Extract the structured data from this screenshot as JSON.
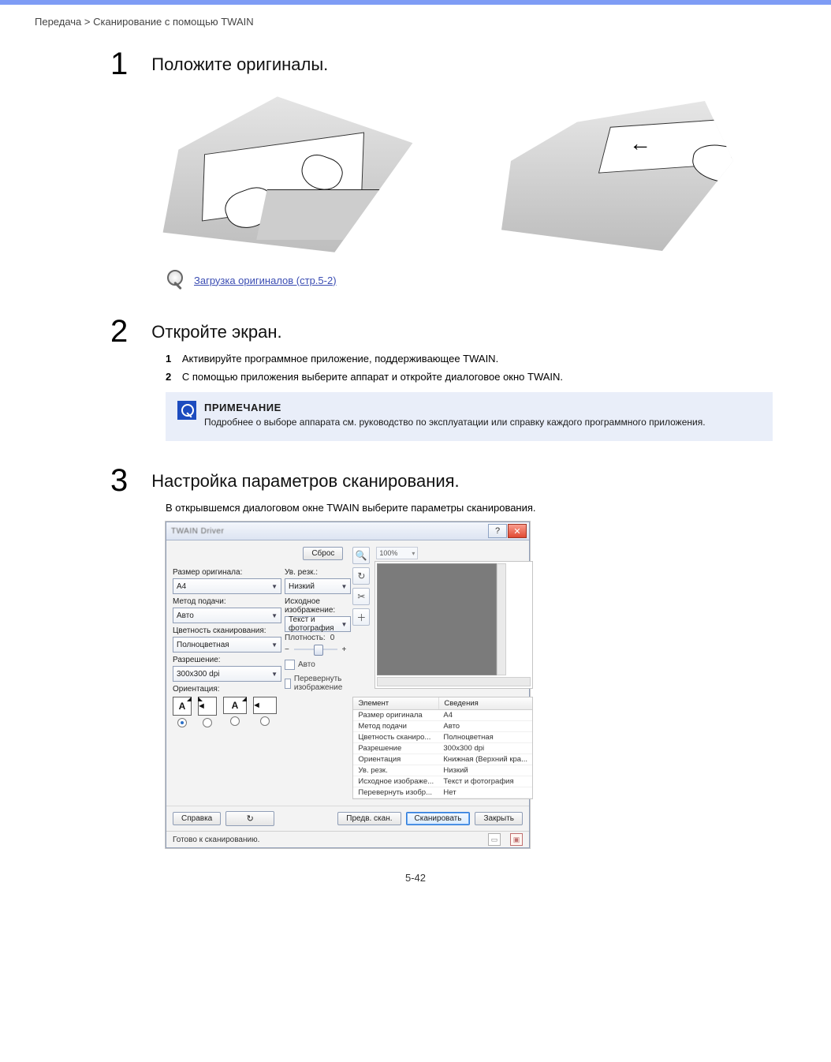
{
  "header": {
    "left": "Передача > Сканирование с помощью TWAIN",
    "page": "5-42"
  },
  "step1": {
    "num": "1",
    "title": "Положите оригиналы.",
    "ref_link": "Загрузка оригиналов (стр.5-2)"
  },
  "step2": {
    "num": "2",
    "title": "Откройте экран.",
    "lines": [
      {
        "label": "1",
        "text": "Активируйте программное приложение, поддерживающее TWAIN."
      },
      {
        "label": "2",
        "text": "С помощью приложения выберите аппарат и откройте диалоговое окно TWAIN."
      }
    ]
  },
  "note": {
    "title": "ПРИМЕЧАНИЕ",
    "body": "Подробнее о выборе аппарата см. руководство по эксплуатации или справку каждого программного приложения."
  },
  "step3": {
    "num": "3",
    "title": "Настройка параметров сканирования.",
    "sub": "В открывшемся диалоговом окне TWAIN выберите параметры сканирования."
  },
  "dialog": {
    "title_blur": "TWAIN Driver",
    "reset_btn": "Сброс",
    "left": {
      "orig_size_label": "Размер оригинала:",
      "orig_size_value": "A4",
      "feed_label": "Метод подачи:",
      "feed_value": "Авто",
      "color_label": "Цветность сканирования:",
      "color_value": "Полноцветная",
      "res_label": "Разрешение:",
      "res_value": "300x300 dpi",
      "orient_label": "Ориентация:"
    },
    "right_col": {
      "sharp_label": "Ув. резк.:",
      "sharp_value": "Низкий",
      "img_label": "Исходное изображение:",
      "img_value": "Текст и фотография",
      "density_label": "Плотность:",
      "density_value": "0",
      "chk_auto": "Авто",
      "chk_flip": "Перевернуть изображение"
    },
    "zoom": "100%",
    "tools": {
      "zoom_in": "zoom-in-icon",
      "rotate": "rotate-icon",
      "crop": "crop-icon",
      "fit": "fit-icon"
    },
    "table": {
      "head_el": "Элемент",
      "head_val": "Сведения",
      "rows": [
        {
          "k": "Размер оригинала",
          "v": "A4"
        },
        {
          "k": "Метод подачи",
          "v": "Авто"
        },
        {
          "k": "Цветность сканиро...",
          "v": "Полноцветная"
        },
        {
          "k": "Разрешение",
          "v": "300x300 dpi"
        },
        {
          "k": "Ориентация",
          "v": "Книжная (Верхний кра..."
        },
        {
          "k": "Ув. резк.",
          "v": "Низкий"
        },
        {
          "k": "Исходное изображе...",
          "v": "Текст и фотография"
        },
        {
          "k": "Перевернуть изобр...",
          "v": "Нет"
        }
      ]
    },
    "footer": {
      "help": "Справка",
      "refresh_icon": "↻",
      "preview": "Предв. скан.",
      "scan": "Сканировать",
      "close": "Закрыть"
    },
    "status": "Готово к сканированию."
  },
  "page_number": "5-42"
}
